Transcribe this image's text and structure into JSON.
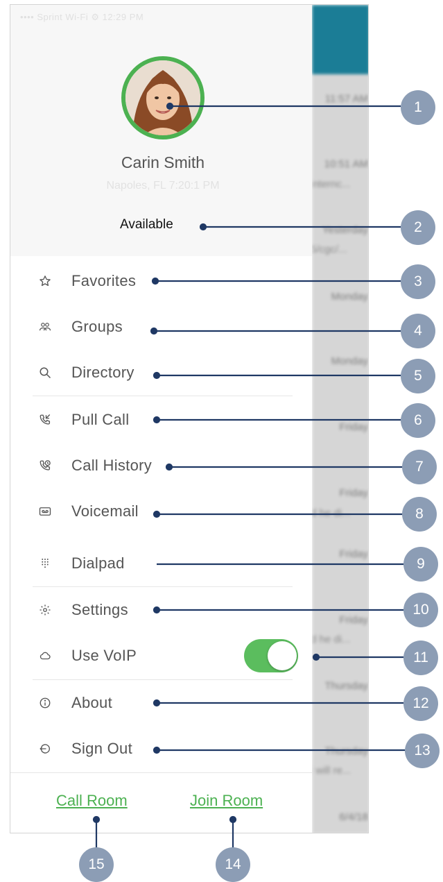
{
  "status_bar": {
    "text": "•••• Sprint Wi-Fi ⚙        12:29 PM"
  },
  "profile": {
    "name": "Carin Smith",
    "subtitle": "Napoles, FL 7:20:1 PM",
    "presence": "Available",
    "avatar_ring_color": "#4cb151"
  },
  "menu": {
    "items": [
      {
        "label": "Favorites",
        "icon": "star-icon"
      },
      {
        "label": "Groups",
        "icon": "groups-icon"
      },
      {
        "label": "Directory",
        "icon": "search-icon"
      },
      {
        "label": "Pull Call",
        "icon": "pull-call-icon"
      },
      {
        "label": "Call History",
        "icon": "call-history-icon"
      },
      {
        "label": "Voicemail",
        "icon": "voicemail-icon"
      },
      {
        "label": "Dialpad",
        "icon": "dialpad-icon"
      },
      {
        "label": "Settings",
        "icon": "gear-icon"
      },
      {
        "label": "Use VoIP",
        "icon": "cloud-icon"
      },
      {
        "label": "About",
        "icon": "info-icon"
      },
      {
        "label": "Sign Out",
        "icon": "sign-out-icon"
      }
    ],
    "voip_enabled": true,
    "accent_color": "#5bbd5e"
  },
  "footer": {
    "call_room": "Call Room",
    "join_room": "Join Room",
    "link_color": "#4cb151"
  },
  "background_list": {
    "items": [
      "11:57 AM",
      "10:51 AM",
      "Yesterday",
      "Monday",
      "Monday",
      "Friday",
      "Friday",
      "Friday",
      "Friday",
      "Thursday",
      "Thursday",
      "6/4/18"
    ],
    "snippets": [
      "internc...",
      "5/cgc/...",
      "d he di...",
      "d he di...",
      "i will re..."
    ]
  },
  "callouts": {
    "labels": [
      "1",
      "2",
      "3",
      "4",
      "5",
      "6",
      "7",
      "8",
      "9",
      "10",
      "11",
      "12",
      "13",
      "14",
      "15"
    ],
    "color": "#8c9db5",
    "line_color": "#1f3864"
  }
}
